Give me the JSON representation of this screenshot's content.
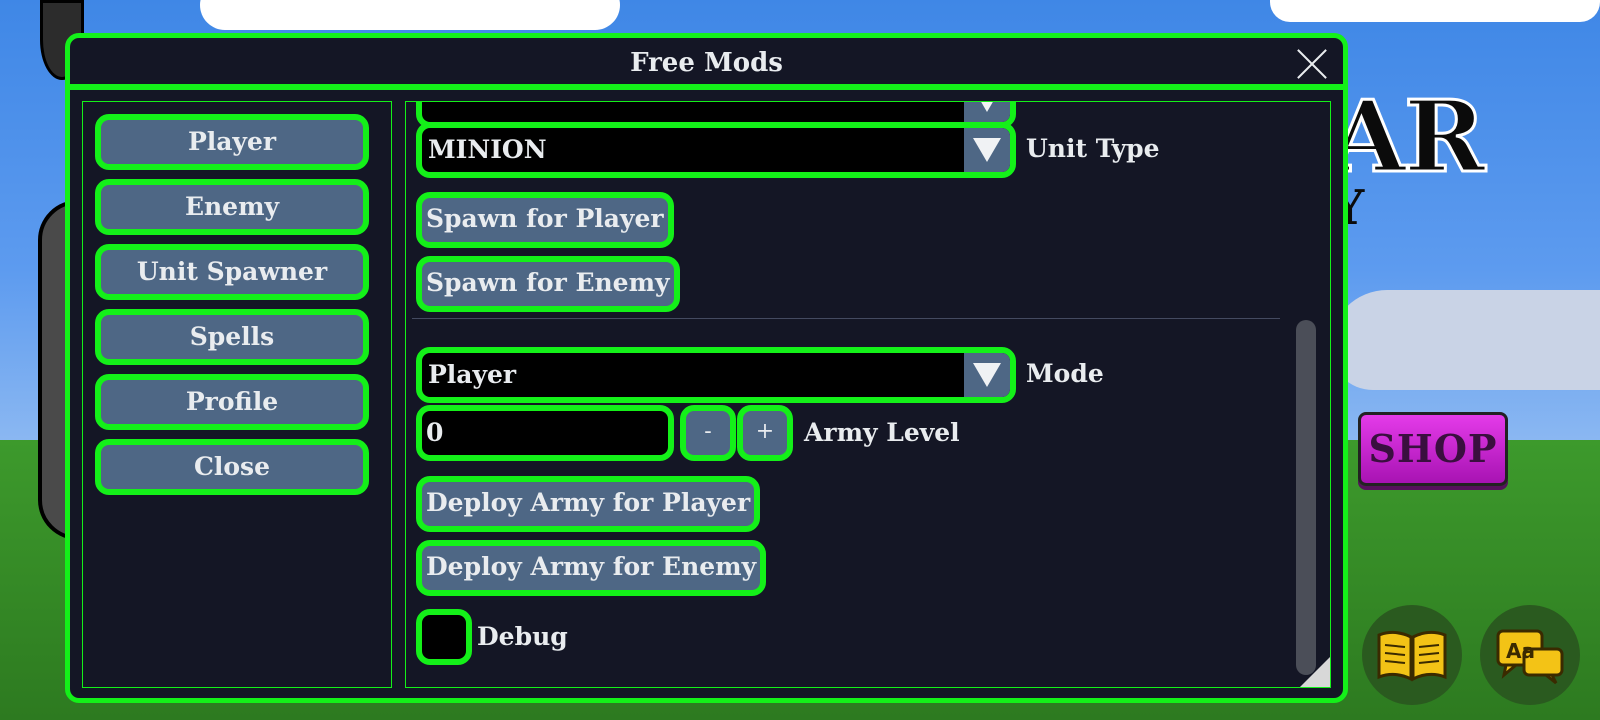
{
  "window": {
    "title": "Free Mods"
  },
  "nav": {
    "items": [
      {
        "label": "Player"
      },
      {
        "label": "Enemy"
      },
      {
        "label": "Unit Spawner"
      },
      {
        "label": "Spells"
      },
      {
        "label": "Profile"
      },
      {
        "label": "Close"
      }
    ]
  },
  "spawner": {
    "unit_type": {
      "value": "MINION",
      "label": "Unit Type"
    },
    "spawn_player_label": "Spawn for Player",
    "spawn_enemy_label": "Spawn for Enemy"
  },
  "army": {
    "mode": {
      "value": "Player",
      "label": "Mode"
    },
    "level": {
      "value": "0",
      "label": "Army Level",
      "minus": "-",
      "plus": "+"
    },
    "deploy_player_label": "Deploy Army for Player",
    "deploy_enemy_label": "Deploy Army for Enemy",
    "debug_label": "Debug"
  },
  "background": {
    "shop_label": "SHOP",
    "book_icon": "book-icon",
    "language_icon": "language-icon"
  },
  "colors": {
    "accent_green": "#14f019",
    "button_fill": "#4e6785",
    "panel_bg": "#141625",
    "shop_magenta": "#d52fda"
  }
}
